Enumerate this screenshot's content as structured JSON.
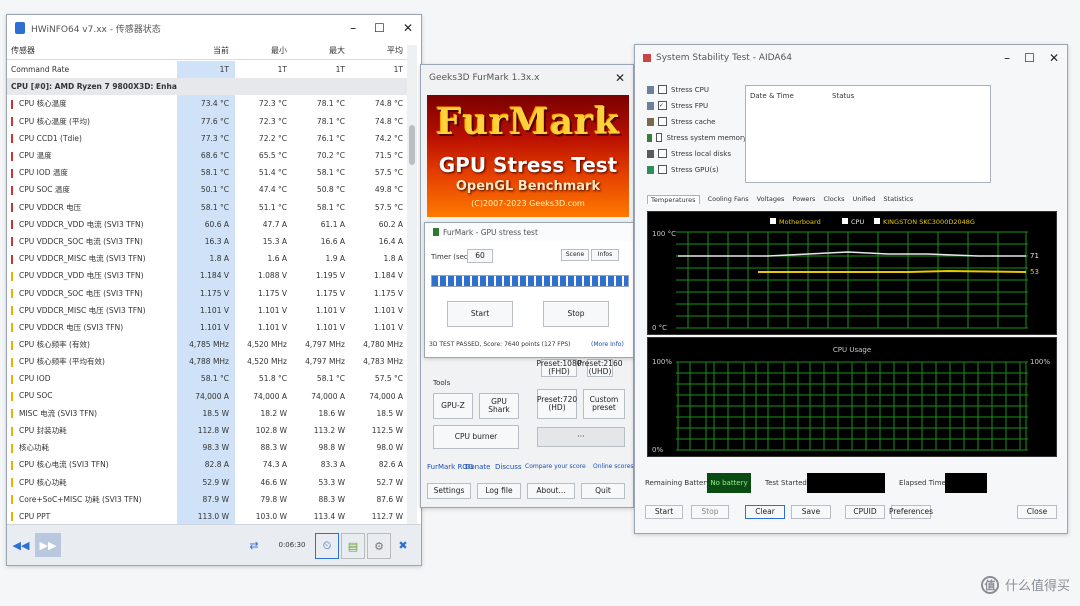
{
  "hwinfo": {
    "title": "HWiNFO64 v7.xx - 传感器状态",
    "columns": [
      "传感器",
      "当前",
      "最小",
      "最大",
      "平均"
    ],
    "rows": [
      {
        "name": "Command Rate",
        "v": [
          "1T",
          "1T",
          "1T",
          "1T"
        ],
        "t": "plain"
      },
      {
        "name": "CPU [#0]: AMD Ryzen 7 9800X3D: Enhanced",
        "v": [
          "",
          "",
          "",
          ""
        ],
        "t": "group"
      },
      {
        "name": "CPU 核心温度",
        "v": [
          "73.4 °C",
          "72.3 °C",
          "78.1 °C",
          "74.8 °C"
        ],
        "t": "r"
      },
      {
        "name": "CPU 核心温度 (平均)",
        "v": [
          "77.6 °C",
          "72.3 °C",
          "78.1 °C",
          "74.8 °C"
        ],
        "t": "r"
      },
      {
        "name": "CPU CCD1 (Tdie)",
        "v": [
          "77.3 °C",
          "72.2 °C",
          "76.1 °C",
          "74.2 °C"
        ],
        "t": "r"
      },
      {
        "name": "CPU 温度",
        "v": [
          "68.6 °C",
          "65.5 °C",
          "70.2 °C",
          "71.5 °C"
        ],
        "t": "r"
      },
      {
        "name": "CPU IOD 温度",
        "v": [
          "58.1 °C",
          "51.4 °C",
          "58.1 °C",
          "57.5 °C"
        ],
        "t": "r"
      },
      {
        "name": "CPU SOC 温度",
        "v": [
          "50.1 °C",
          "47.4 °C",
          "50.8 °C",
          "49.8 °C"
        ],
        "t": "r"
      },
      {
        "name": "CPU VDDCR 电压",
        "v": [
          "58.1 °C",
          "51.1 °C",
          "58.1 °C",
          "57.5 °C"
        ],
        "t": "r"
      },
      {
        "name": "CPU VDDCR_VDD 电流 (SVI3 TFN)",
        "v": [
          "60.6 A",
          "47.7 A",
          "61.1 A",
          "60.2 A"
        ],
        "t": "r"
      },
      {
        "name": "CPU VDDCR_SOC 电流 (SVI3 TFN)",
        "v": [
          "16.3 A",
          "15.3 A",
          "16.6 A",
          "16.4 A"
        ],
        "t": "r"
      },
      {
        "name": "CPU VDDCR_MISC 电流 (SVI3 TFN)",
        "v": [
          "1.8 A",
          "1.6 A",
          "1.9 A",
          "1.8 A"
        ],
        "t": "r"
      },
      {
        "name": "CPU VDDCR_VDD 电压 (SVI3 TFN)",
        "v": [
          "1.184 V",
          "1.088 V",
          "1.195 V",
          "1.184 V"
        ],
        "t": "y"
      },
      {
        "name": "CPU VDDCR_SOC 电压 (SVI3 TFN)",
        "v": [
          "1.175 V",
          "1.175 V",
          "1.175 V",
          "1.175 V"
        ],
        "t": "y"
      },
      {
        "name": "CPU VDDCR_MISC 电压 (SVI3 TFN)",
        "v": [
          "1.101 V",
          "1.101 V",
          "1.101 V",
          "1.101 V"
        ],
        "t": "y"
      },
      {
        "name": "CPU VDDCR 电压 (SVI3 TFN)",
        "v": [
          "1.101 V",
          "1.101 V",
          "1.101 V",
          "1.101 V"
        ],
        "t": "y"
      },
      {
        "name": "CPU 核心频率 (有效)",
        "v": [
          "4,785 MHz",
          "4,520 MHz",
          "4,797 MHz",
          "4,780 MHz"
        ],
        "t": "y"
      },
      {
        "name": "CPU 核心频率 (平均有效)",
        "v": [
          "4,788 MHz",
          "4,520 MHz",
          "4,797 MHz",
          "4,783 MHz"
        ],
        "t": "y"
      },
      {
        "name": "CPU IOD",
        "v": [
          "58.1 °C",
          "51.8 °C",
          "58.1 °C",
          "57.5 °C"
        ],
        "t": "y"
      },
      {
        "name": "CPU SOC",
        "v": [
          "74,000 A",
          "74,000 A",
          "74,000 A",
          "74,000 A"
        ],
        "t": "y"
      },
      {
        "name": "MISC 电流 (SVI3 TFN)",
        "v": [
          "18.5 W",
          "18.2 W",
          "18.6 W",
          "18.5 W"
        ],
        "t": "y"
      },
      {
        "name": "CPU 封装功耗",
        "v": [
          "112.8 W",
          "102.8 W",
          "113.2 W",
          "112.5 W"
        ],
        "t": "y"
      },
      {
        "name": "核心功耗",
        "v": [
          "98.3 W",
          "88.3 W",
          "98.8 W",
          "98.0 W"
        ],
        "t": "y"
      },
      {
        "name": "CPU 核心电流 (SVI3 TFN)",
        "v": [
          "82.8 A",
          "74.3 A",
          "83.3 A",
          "82.6 A"
        ],
        "t": "y"
      },
      {
        "name": "CPU 核心功耗",
        "v": [
          "52.9 W",
          "46.6 W",
          "53.3 W",
          "52.7 W"
        ],
        "t": "y"
      },
      {
        "name": "Core+SoC+MISC 功耗 (SVI3 TFN)",
        "v": [
          "87.9 W",
          "79.8 W",
          "88.3 W",
          "87.6 W"
        ],
        "t": "y"
      },
      {
        "name": "CPU PPT",
        "v": [
          "113.0 W",
          "103.0 W",
          "113.4 W",
          "112.7 W"
        ],
        "t": "y"
      }
    ],
    "footer": {
      "timer": "0:06:30"
    }
  },
  "furmark": {
    "title": "Geeks3D FurMark 1.3x.x",
    "banner": {
      "logo": "FurMark",
      "line1": "GPU Stress Test",
      "line2": "OpenGL Benchmark",
      "line3": "(C)2007-2023 Geeks3D.com"
    },
    "buttons": [
      {
        "k": "gpuz",
        "label": "GPU-Z"
      },
      {
        "k": "gpushark",
        "label": "GPU Shark"
      },
      {
        "k": "cpuburner",
        "label": "CPU burner"
      },
      {
        "k": "customize",
        "label": "Custom preset"
      },
      {
        "k": "preset_hd",
        "label": "Preset:720 (HD)"
      },
      {
        "k": "preset_fhd",
        "label": "Preset:1080 (FHD)"
      },
      {
        "k": "p2160",
        "label": "Preset:2160 (UHD)"
      },
      {
        "k": "settings",
        "label": "Settings"
      },
      {
        "k": "log",
        "label": "Log file"
      },
      {
        "k": "about",
        "label": "About..."
      },
      {
        "k": "quit",
        "label": "Quit"
      }
    ],
    "section_tools": "Tools",
    "links": [
      "FurMark ROG",
      "Donate",
      "Discuss",
      "Compare your score",
      "Online scores"
    ],
    "dialog": {
      "title": "FurMark - GPU stress test",
      "timer_label": "Timer (sec)",
      "timer_value": "60",
      "tab1": "Scene",
      "tab2": "Infos",
      "btn_start": "Start",
      "btn_stop": "Stop",
      "status": "3D TEST PASSED, Score: 7640 points (127 FPS)",
      "link_more": "(More Info)",
      "progress": 0.96
    }
  },
  "aida": {
    "title": "System Stability Test - AIDA64",
    "checks": [
      {
        "label": "Stress CPU",
        "checked": false,
        "ic": "#6b7fa0"
      },
      {
        "label": "Stress FPU",
        "checked": true,
        "ic": "#6b7fa0"
      },
      {
        "label": "Stress cache",
        "checked": false,
        "ic": "#7a6a4a"
      },
      {
        "label": "Stress system memory",
        "checked": false,
        "ic": "#3a7a3a"
      },
      {
        "label": "Stress local disks",
        "checked": false,
        "ic": "#5a5a5a"
      },
      {
        "label": "Stress GPU(s)",
        "checked": false,
        "ic": "#2f8f5a"
      }
    ],
    "info_headers": [
      "Date & Time",
      "Status"
    ],
    "tabs": [
      "Temperatures",
      "Cooling Fans",
      "Voltages",
      "Powers",
      "Clocks",
      "Unified",
      "Statistics"
    ],
    "graph1_legend": [
      "Motherboard",
      "CPU",
      "KINGSTON SKC3000D2048G"
    ],
    "graph1_ymax": "100 °C",
    "graph1_ymin": "0 °C",
    "graph1_r1": "71",
    "graph1_r2": "53",
    "graph2_title": "CPU Usage",
    "graph2_ymax": "100%",
    "graph2_ymin": "0%",
    "graph2_rmax": "100%",
    "battery_label": "Remaining Battery:",
    "battery_value": "No battery",
    "started_label": "Test Started:",
    "elapsed_label": "Elapsed Time:",
    "buttons": [
      "Start",
      "Stop",
      "Clear",
      "Save",
      "CPUID",
      "Preferences",
      "Close"
    ]
  },
  "watermark": {
    "text": "什么值得买",
    "badge": "值"
  }
}
